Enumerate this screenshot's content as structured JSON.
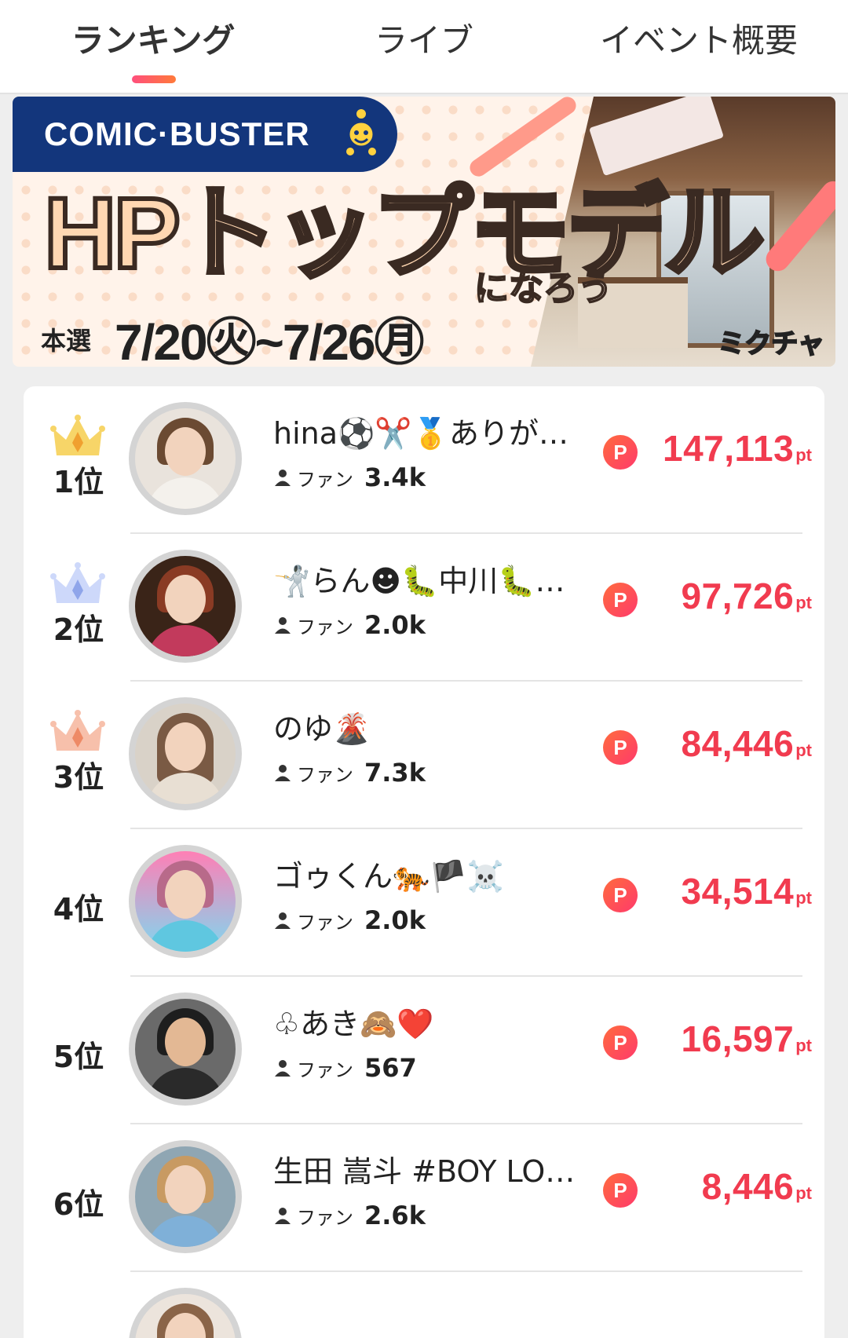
{
  "tabs": [
    {
      "label": "ランキング",
      "active": true
    },
    {
      "label": "ライブ",
      "active": false
    },
    {
      "label": "イベント概要",
      "active": false
    }
  ],
  "banner": {
    "brand": "COMIC·BUSTER",
    "headline": "HPトップモデル",
    "subline": "になろう",
    "date_label": "本選",
    "date_range": "7/20㊋~7/26㊊",
    "credit": "ミクチャ"
  },
  "colors": {
    "accent": "#f13b4f",
    "gold_crown": "#f7c948",
    "silver_crown": "#b9c8f5",
    "bronze_crown": "#f4ad93"
  },
  "fans_label": "ファン",
  "score_unit": "pt",
  "point_icon_label": "P",
  "ranking": [
    {
      "rank": "1位",
      "crown": "gold",
      "name": "hina⚽️✂️🥇ありが…",
      "fans": "3.4k",
      "score": "147,113"
    },
    {
      "rank": "2位",
      "crown": "silver",
      "name": "🤺らん☻🐛中川🐛…",
      "fans": "2.0k",
      "score": "97,726"
    },
    {
      "rank": "3位",
      "crown": "bronze",
      "name": "のゆ🌋",
      "fans": "7.3k",
      "score": "84,446"
    },
    {
      "rank": "4位",
      "crown": "",
      "name": "ゴゥくん🐅🏴☠️",
      "fans": "2.0k",
      "score": "34,514"
    },
    {
      "rank": "5位",
      "crown": "",
      "name": "♧あき🙈❤️",
      "fans": "567",
      "score": "16,597"
    },
    {
      "rank": "6位",
      "crown": "",
      "name": "生田 嵩斗 #BOY LO…",
      "fans": "2.6k",
      "score": "8,446"
    }
  ]
}
